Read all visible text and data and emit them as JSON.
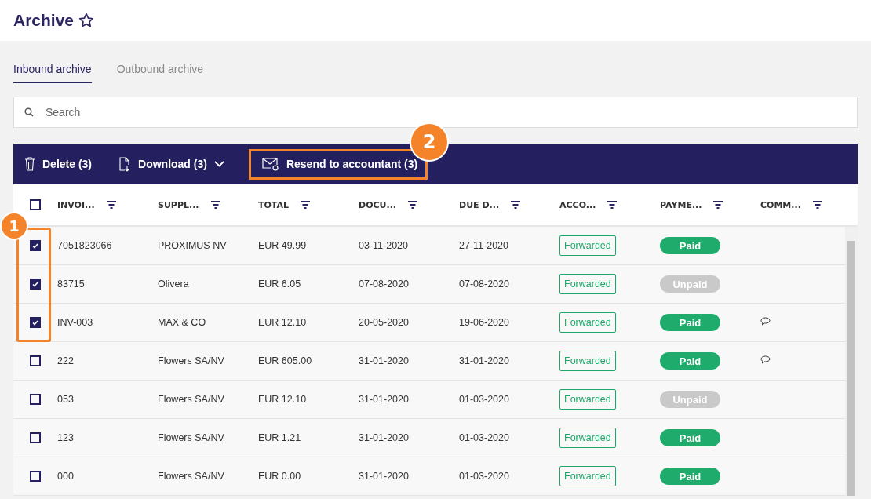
{
  "page": {
    "title": "Archive"
  },
  "tabs": [
    {
      "label": "Inbound archive",
      "selected": true
    },
    {
      "label": "Outbound archive",
      "selected": false
    }
  ],
  "search": {
    "placeholder": "Search"
  },
  "toolbar": {
    "actions": [
      {
        "kind": "delete",
        "label": "Delete (3)"
      },
      {
        "kind": "download",
        "label": "Download (3)"
      },
      {
        "kind": "resend",
        "label": "Resend to accountant (3)"
      }
    ]
  },
  "table": {
    "select_all_checked": false,
    "columns": [
      "INVOI...",
      "SUPPL...",
      "TOTAL",
      "DOCU...",
      "DUE D...",
      "ACCO...",
      "PAYME...",
      "COMM..."
    ],
    "rows": [
      {
        "checked": true,
        "invoice": "7051823066",
        "supplier": "PROXIMUS NV",
        "total": "EUR 49.99",
        "document_date": "03-11-2020",
        "due_date": "27-11-2020",
        "accountant": "Forwarded",
        "payment": "Paid",
        "paid": true,
        "comment": false
      },
      {
        "checked": true,
        "invoice": "83715",
        "supplier": "Olivera",
        "total": "EUR 6.05",
        "document_date": "07-08-2020",
        "due_date": "07-08-2020",
        "accountant": "Forwarded",
        "payment": "Unpaid",
        "paid": false,
        "comment": false
      },
      {
        "checked": true,
        "invoice": "INV-003",
        "supplier": "MAX & CO",
        "total": "EUR 12.10",
        "document_date": "20-05-2020",
        "due_date": "19-06-2020",
        "accountant": "Forwarded",
        "payment": "Paid",
        "paid": true,
        "comment": true
      },
      {
        "checked": false,
        "invoice": "222",
        "supplier": "Flowers SA/NV",
        "total": "EUR 605.00",
        "document_date": "31-01-2020",
        "due_date": "31-01-2020",
        "accountant": "Forwarded",
        "payment": "Paid",
        "paid": true,
        "comment": true
      },
      {
        "checked": false,
        "invoice": "053",
        "supplier": "Flowers SA/NV",
        "total": "EUR 12.10",
        "document_date": "31-01-2020",
        "due_date": "01-03-2020",
        "accountant": "Forwarded",
        "payment": "Unpaid",
        "paid": false,
        "comment": false
      },
      {
        "checked": false,
        "invoice": "123",
        "supplier": "Flowers SA/NV",
        "total": "EUR 1.21",
        "document_date": "31-01-2020",
        "due_date": "01-03-2020",
        "accountant": "Forwarded",
        "payment": "Paid",
        "paid": true,
        "comment": false
      },
      {
        "checked": false,
        "invoice": "000",
        "supplier": "Flowers SA/NV",
        "total": "EUR 0.00",
        "document_date": "31-01-2020",
        "due_date": "01-03-2020",
        "accountant": "Forwarded",
        "payment": "Paid",
        "paid": true,
        "comment": false
      }
    ]
  },
  "callouts": [
    {
      "label": "1"
    },
    {
      "label": "2"
    }
  ]
}
